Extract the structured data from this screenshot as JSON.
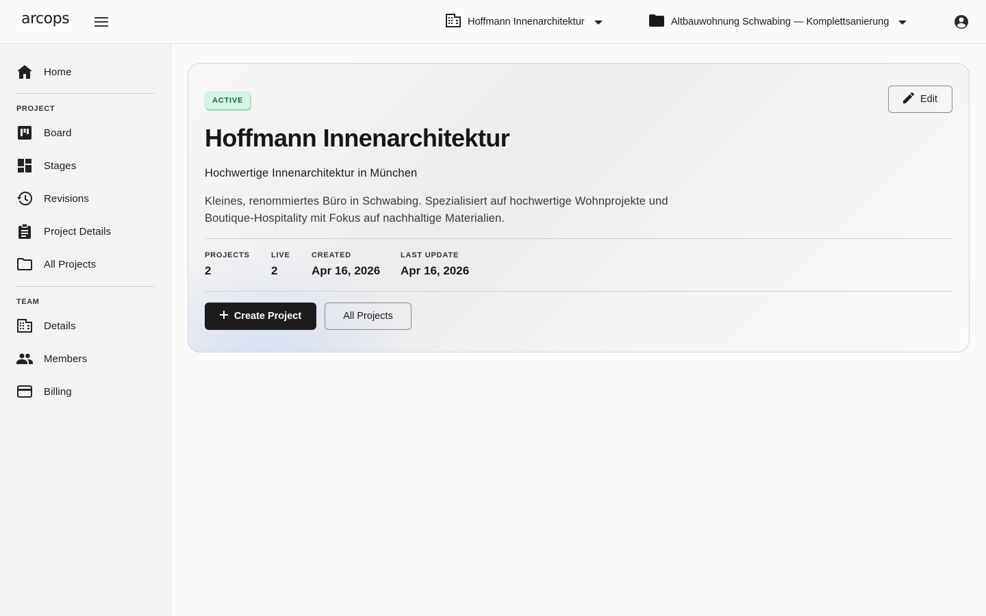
{
  "app": {
    "logo_text": "arcops"
  },
  "header": {
    "menu_icon": "hamburger-menu-icon",
    "org_selector": {
      "icon": "building-icon",
      "label": "Hoffmann Innenarchitektur",
      "chevron": "dropdown-arrow-icon"
    },
    "project_selector": {
      "icon": "folder-icon",
      "label": "Altbauwohnung Schwabing — Komplettsanierung",
      "chevron": "dropdown-arrow-icon"
    },
    "account_icon": "account-circle-icon"
  },
  "sidebar": {
    "home": {
      "label": "Home",
      "icon": "home-icon"
    },
    "project_section": {
      "title": "PROJECT",
      "items": [
        {
          "label": "Board",
          "icon": "board-icon"
        },
        {
          "label": "Stages",
          "icon": "dashboard-icon"
        },
        {
          "label": "Revisions",
          "icon": "history-icon"
        },
        {
          "label": "Project Details",
          "icon": "clipboard-icon"
        },
        {
          "label": "All Projects",
          "icon": "folder-outline-icon"
        }
      ]
    },
    "team_section": {
      "title": "TEAM",
      "items": [
        {
          "label": "Details",
          "icon": "building-icon"
        },
        {
          "label": "Members",
          "icon": "people-icon"
        },
        {
          "label": "Billing",
          "icon": "credit-card-icon"
        }
      ]
    }
  },
  "card": {
    "status_badge": "ACTIVE",
    "edit_label": "Edit",
    "title": "Hoffmann Innenarchitektur",
    "subtitle": "Hochwertige Innenarchitektur in München",
    "description": "Kleines, renommiertes Büro in Schwabing. Spezialisiert auf hochwertige Wohnprojekte und Boutique-Hospitality mit Fokus auf nachhaltige Materialien.",
    "stats": [
      {
        "label": "PROJECTS",
        "value": "2"
      },
      {
        "label": "LIVE",
        "value": "2"
      },
      {
        "label": "CREATED",
        "value": "Apr 16, 2026"
      },
      {
        "label": "LAST UPDATE",
        "value": "Apr 16, 2026"
      }
    ],
    "primary_action": "Create Project",
    "secondary_action": "All Projects"
  },
  "colors": {
    "badge_bg": "#d7f5e7",
    "badge_text": "#14663f",
    "primary_button": "#1c1c1e"
  }
}
